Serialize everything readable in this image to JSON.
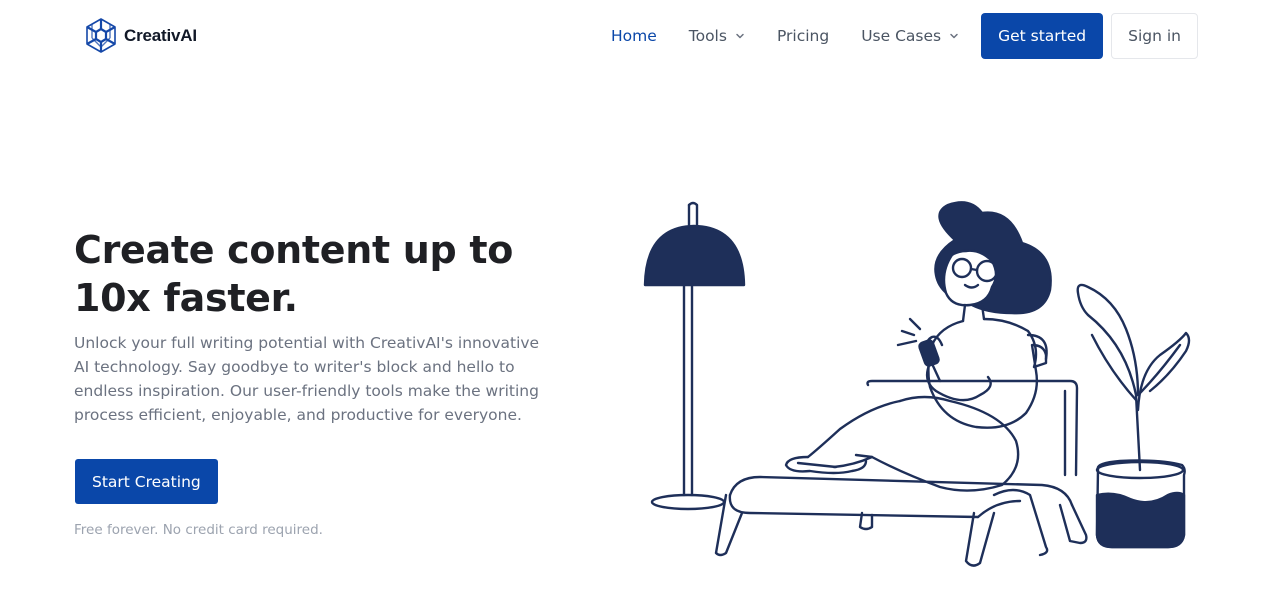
{
  "brand": {
    "name": "CreativAI"
  },
  "nav": {
    "home": "Home",
    "tools": "Tools",
    "pricing": "Pricing",
    "use_cases": "Use Cases",
    "get_started": "Get started",
    "sign_in": "Sign in"
  },
  "hero": {
    "title": "Create content up to 10x faster.",
    "subtitle": "Unlock your full writing potential with CreativAI's innovative AI technology. Say goodbye to writer's block and hello to endless inspiration. Our user-friendly tools make the writing process efficient, enjoyable, and productive for everyone.",
    "cta": "Start Creating",
    "note": "Free forever. No credit card required."
  },
  "icons": {
    "logo": "hexagon-spiral-logo",
    "dropdown": "chevron-down-icon",
    "illustration": "woman-on-lounge-chair-illustration"
  },
  "colors": {
    "brand": "#0a47a9",
    "illustration_fill": "#1e2f59",
    "text_dark": "#1f2024",
    "text_muted": "#6b7280"
  }
}
